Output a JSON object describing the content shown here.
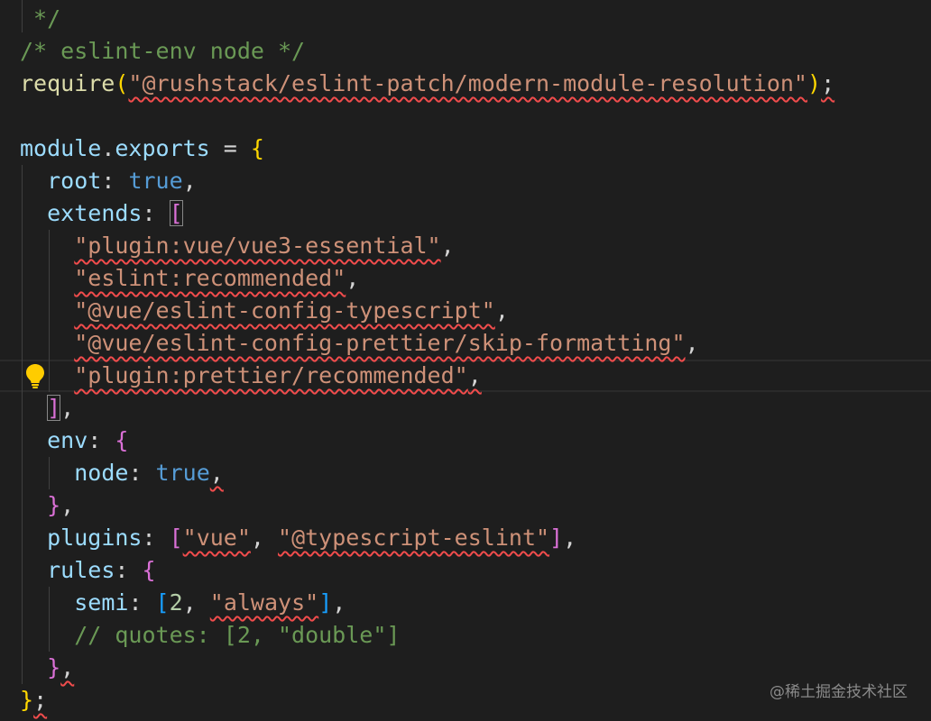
{
  "editor": {
    "lines": [
      [
        {
          "t": " */",
          "c": "comment"
        }
      ],
      [
        {
          "t": "/* eslint-env node */",
          "c": "comment"
        }
      ],
      [
        {
          "t": "require",
          "c": "fn"
        },
        {
          "t": "(",
          "c": "br-gold"
        },
        {
          "t": "\"@rushstack/eslint-patch/modern-module-resolution\"",
          "c": "str squiggle"
        },
        {
          "t": ")",
          "c": "br-gold"
        },
        {
          "t": ";",
          "c": "punc squiggle"
        }
      ],
      [],
      [
        {
          "t": "module",
          "c": "var"
        },
        {
          "t": ".",
          "c": "punc"
        },
        {
          "t": "exports",
          "c": "var"
        },
        {
          "t": " = ",
          "c": "punc"
        },
        {
          "t": "{",
          "c": "br-gold"
        }
      ],
      [
        {
          "t": "  ",
          "c": "punc"
        },
        {
          "t": "root",
          "c": "var"
        },
        {
          "t": ": ",
          "c": "punc"
        },
        {
          "t": "true",
          "c": "kw"
        },
        {
          "t": ",",
          "c": "punc"
        }
      ],
      [
        {
          "t": "  ",
          "c": "punc"
        },
        {
          "t": "extends",
          "c": "var"
        },
        {
          "t": ": ",
          "c": "punc"
        },
        {
          "t": "[",
          "c": "br-pink bracket-match"
        }
      ],
      [
        {
          "t": "    ",
          "c": "punc"
        },
        {
          "t": "\"plugin:vue/vue3-essential\"",
          "c": "str squiggle"
        },
        {
          "t": ",",
          "c": "punc"
        }
      ],
      [
        {
          "t": "    ",
          "c": "punc"
        },
        {
          "t": "\"eslint:recommended\"",
          "c": "str squiggle"
        },
        {
          "t": ",",
          "c": "punc"
        }
      ],
      [
        {
          "t": "    ",
          "c": "punc"
        },
        {
          "t": "\"@vue/eslint-config-typescript\"",
          "c": "str squiggle"
        },
        {
          "t": ",",
          "c": "punc"
        }
      ],
      [
        {
          "t": "    ",
          "c": "punc"
        },
        {
          "t": "\"@vue/eslint-config-prettier/skip-formatting\"",
          "c": "str squiggle"
        },
        {
          "t": ",",
          "c": "punc"
        }
      ],
      [
        {
          "t": "    ",
          "c": "punc"
        },
        {
          "t": "\"plugin:prettier/recommended\"",
          "c": "str squiggle"
        },
        {
          "t": ",",
          "c": "punc squiggle"
        }
      ],
      [
        {
          "t": "  ",
          "c": "punc"
        },
        {
          "t": "]",
          "c": "br-pink bracket-match"
        },
        {
          "t": ",",
          "c": "punc"
        }
      ],
      [
        {
          "t": "  ",
          "c": "punc"
        },
        {
          "t": "env",
          "c": "var"
        },
        {
          "t": ": ",
          "c": "punc"
        },
        {
          "t": "{",
          "c": "br-pink"
        }
      ],
      [
        {
          "t": "    ",
          "c": "punc"
        },
        {
          "t": "node",
          "c": "var"
        },
        {
          "t": ": ",
          "c": "punc"
        },
        {
          "t": "true",
          "c": "kw"
        },
        {
          "t": ",",
          "c": "punc squiggle"
        }
      ],
      [
        {
          "t": "  ",
          "c": "punc"
        },
        {
          "t": "}",
          "c": "br-pink"
        },
        {
          "t": ",",
          "c": "punc"
        }
      ],
      [
        {
          "t": "  ",
          "c": "punc"
        },
        {
          "t": "plugins",
          "c": "var"
        },
        {
          "t": ": ",
          "c": "punc"
        },
        {
          "t": "[",
          "c": "br-pink"
        },
        {
          "t": "\"vue\"",
          "c": "str squiggle"
        },
        {
          "t": ", ",
          "c": "punc"
        },
        {
          "t": "\"@typescript-eslint\"",
          "c": "str squiggle"
        },
        {
          "t": "]",
          "c": "br-pink"
        },
        {
          "t": ",",
          "c": "punc"
        }
      ],
      [
        {
          "t": "  ",
          "c": "punc"
        },
        {
          "t": "rules",
          "c": "var"
        },
        {
          "t": ": ",
          "c": "punc"
        },
        {
          "t": "{",
          "c": "br-pink"
        }
      ],
      [
        {
          "t": "    ",
          "c": "punc"
        },
        {
          "t": "semi",
          "c": "var"
        },
        {
          "t": ": ",
          "c": "punc"
        },
        {
          "t": "[",
          "c": "br-blue"
        },
        {
          "t": "2",
          "c": "num"
        },
        {
          "t": ", ",
          "c": "punc"
        },
        {
          "t": "\"always\"",
          "c": "str squiggle"
        },
        {
          "t": "]",
          "c": "br-blue"
        },
        {
          "t": ",",
          "c": "punc"
        }
      ],
      [
        {
          "t": "    // quotes: [2, \"double\"]",
          "c": "comment"
        }
      ],
      [
        {
          "t": "  ",
          "c": "punc"
        },
        {
          "t": "}",
          "c": "br-pink"
        },
        {
          "t": ",",
          "c": "punc squiggle"
        }
      ],
      [
        {
          "t": "}",
          "c": "br-gold"
        },
        {
          "t": ";",
          "c": "punc squiggle"
        }
      ]
    ]
  },
  "lightbulb_icon": "lightbulb-icon",
  "colors": {
    "background": "#1e1e1e",
    "comment": "#6a9955",
    "string": "#ce9178",
    "variable": "#9cdcfe",
    "keyword": "#569cd6",
    "function": "#dcdcaa",
    "error_squiggle": "#f14c4c",
    "lightbulb": "#ffcc00"
  },
  "watermark": "@稀土掘金技术社区"
}
